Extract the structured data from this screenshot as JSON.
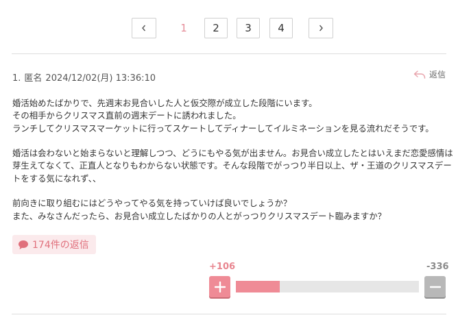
{
  "pagination": {
    "prev_icon": "chevron-left-icon",
    "next_icon": "chevron-right-icon",
    "pages": [
      "1",
      "2",
      "3",
      "4"
    ],
    "current_page": "1"
  },
  "post": {
    "number": "1.",
    "author": "匿名",
    "datetime": "2024/12/02(月) 13:36:10",
    "reply_label": "返信",
    "reply_icon": "reply-arrow-icon",
    "body": [
      "婚活始めたばかりで、先週末お見合いした人と仮交際が成立した段階にいます。",
      "その相手からクリスマス直前の週末デートに誘われました。",
      "ランチしてクリスマスマーケットに行ってスケートしてディナーしてイルミネーションを見る流れだそうです。",
      "",
      "婚活は会わないと始まらないと理解しつつ、どうにもやる気が出ません。お見合い成立したとはいえまだ恋愛感情は",
      "芽生えてなくて、正直人となりもわからない状態です。そんな段階でがっつり半日以上、ザ・王道のクリスマスデー",
      "トをする気になれず、、",
      "",
      "前向きに取り組むにはどうやってやる気を持っていけば良いでしょうか？",
      "また、みなさんだったら、お見合い成立したばかりの人とがっつりクリスマスデート臨みますか？"
    ]
  },
  "replies": {
    "count_label": "174件の返信",
    "icon": "speech-bubble-icon"
  },
  "votes": {
    "plus_label": "+106",
    "minus_label": "-336",
    "plus_icon": "plus-icon",
    "minus_icon": "minus-icon",
    "plus_fraction": 0.24,
    "accent_color": "#ef8b96",
    "neutral_color": "#b8b8b8"
  }
}
